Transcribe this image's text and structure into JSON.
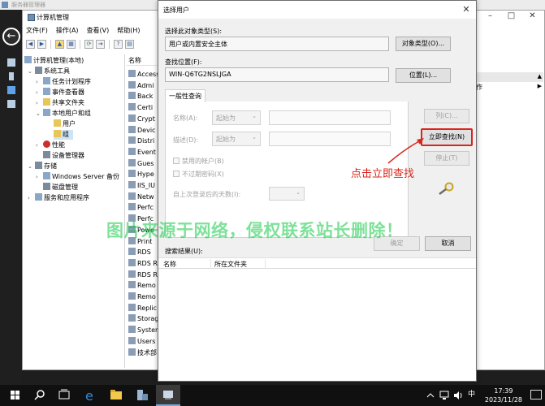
{
  "server_manager": {
    "title": "服务器管理器"
  },
  "computer_management": {
    "title": "计算机管理",
    "menu": [
      "文件(F)",
      "操作(A)",
      "查看(V)",
      "帮助(H)"
    ],
    "tree": [
      {
        "label": "计算机管理(本地)",
        "exp": "",
        "level": 0
      },
      {
        "label": "系统工具",
        "exp": "⌄",
        "level": 1
      },
      {
        "label": "任务计划程序",
        "exp": "›",
        "level": 2
      },
      {
        "label": "事件查看器",
        "exp": "›",
        "level": 2
      },
      {
        "label": "共享文件夹",
        "exp": "›",
        "level": 2
      },
      {
        "label": "本地用户和组",
        "exp": "⌄",
        "level": 2
      },
      {
        "label": "用户",
        "exp": "",
        "level": 3
      },
      {
        "label": "组",
        "exp": "",
        "level": 3
      },
      {
        "label": "性能",
        "exp": "›",
        "level": 2
      },
      {
        "label": "设备管理器",
        "exp": "",
        "level": 2
      },
      {
        "label": "存储",
        "exp": "⌄",
        "level": 1
      },
      {
        "label": "Windows Server 备份",
        "exp": "›",
        "level": 2
      },
      {
        "label": "磁盘管理",
        "exp": "",
        "level": 2
      },
      {
        "label": "服务和应用程序",
        "exp": "›",
        "level": 1
      }
    ],
    "list_header": "名称",
    "list_items": [
      "Access",
      "Admi",
      "Back",
      "Certi",
      "Crypt",
      "Devic",
      "Distri",
      "Event",
      "Gues",
      "Hype",
      "IIS_IU",
      "Netw",
      "Perfc",
      "Perfc",
      "Powe",
      "Print",
      "RDS",
      "RDS R",
      "RDS R",
      "Remo",
      "Remo",
      "Replic",
      "Storag",
      "Syster",
      "Users",
      "技术部"
    ],
    "actions_label": "作"
  },
  "dialog": {
    "title": "选择用户",
    "object_type_label": "选择此对象类型(S):",
    "object_type_value": "用户或内置安全主体",
    "object_type_button": "对象类型(O)...",
    "location_label": "查找位置(F):",
    "location_value": "WIN-Q6TG2NSLJGA",
    "location_button": "位置(L)...",
    "tab_label": "一般性查询",
    "name_label": "名称(A):",
    "name_match": "起始为",
    "desc_label": "描述(D):",
    "desc_match": "起始为",
    "disabled_accounts": "禁用的帐户(B)",
    "non_expiring_pw": "不过期密码(X)",
    "days_since_login": "自上次登录后的天数(I):",
    "columns_button": "列(C)...",
    "find_now_button": "立即查找(N)",
    "stop_button": "停止(T)",
    "ok_button": "确定",
    "cancel_button": "取消",
    "results_label": "搜索结果(U):",
    "results_columns": [
      "名称",
      "所在文件夹"
    ]
  },
  "annotation": "点击立即查找",
  "watermark": "图片来源于网络，侵权联系站长删除！",
  "taskbar": {
    "ime": "中",
    "time": "17:39",
    "date": "2023/11/28"
  }
}
